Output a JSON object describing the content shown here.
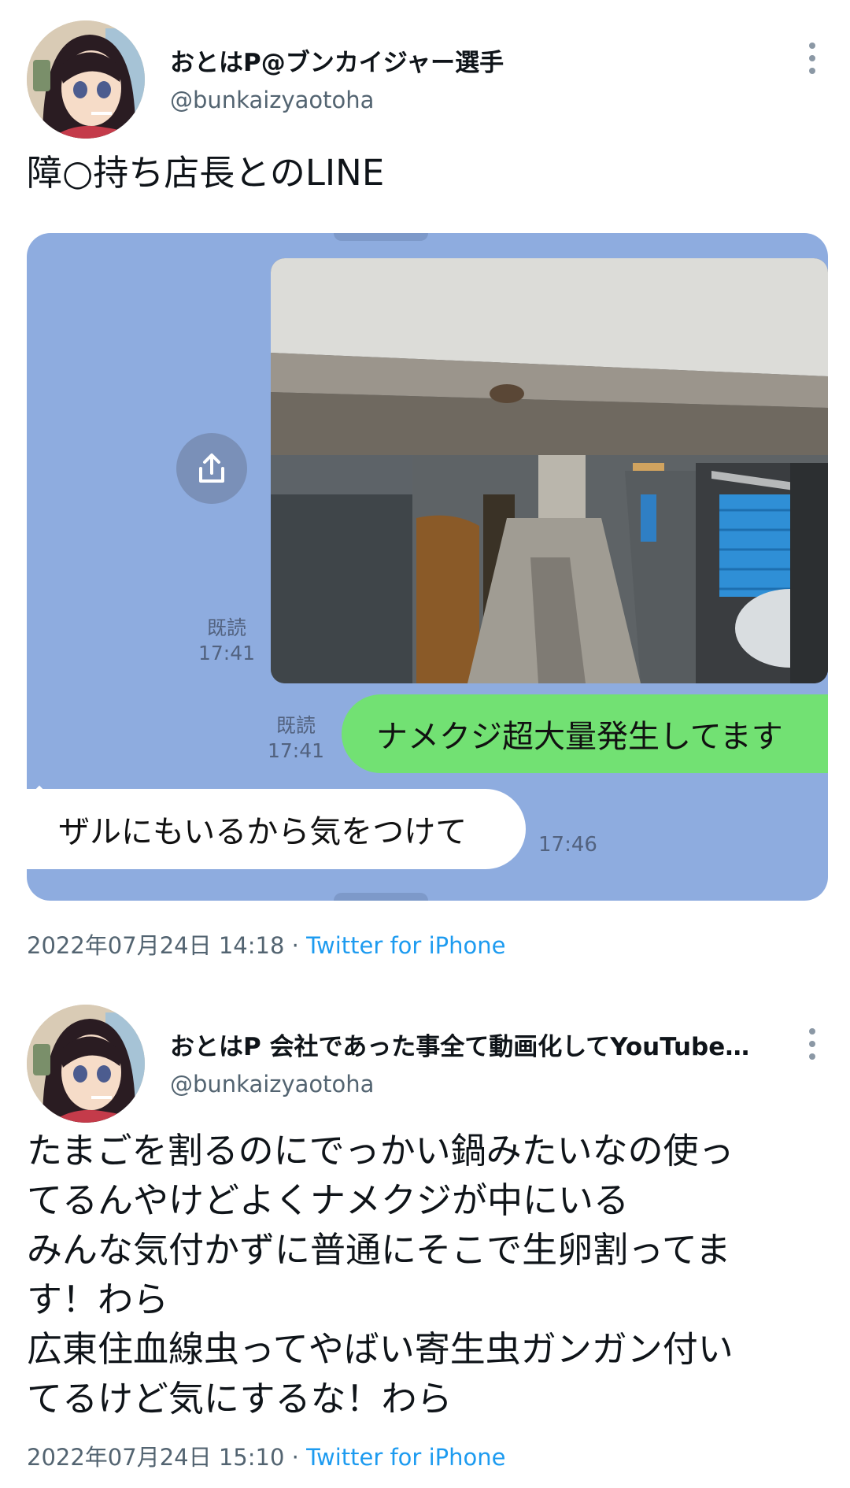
{
  "tweet1": {
    "display_name": "おとはP@ブンカイジャー選手",
    "handle": "@bunkaizyaotoha",
    "text": "障○持ち店長とのLINE",
    "timestamp": "2022年07月24日 14:18",
    "separator": "·",
    "via": "Twitter for iPhone",
    "line_chat": {
      "photo_read": "既読",
      "photo_time": "17:41",
      "sent_message": "ナメクジ超大量発生してます",
      "sent_read": "既読",
      "sent_time": "17:41",
      "received_message": "ザルにもいるから気をつけて",
      "received_time": "17:46"
    }
  },
  "tweet2": {
    "display_name": "おとはP 会社であった事全て動画化してYouTube…",
    "handle": "@bunkaizyaotoha",
    "text": "たまごを割るのにでっかい鍋みたいなの使っ\nてるんやけどよくナメクジが中にいる\nみんな気付かずに普通にそこで生卵割ってま\nす！わら\n広東住血線虫ってやばい寄生虫ガンガン付い\nてるけど気にするな！わら",
    "timestamp": "2022年07月24日 15:10",
    "separator": "·",
    "via": "Twitter for iPhone"
  },
  "colors": {
    "link": "#1d9bf0",
    "secondary_text": "#536471",
    "line_background": "#8eacdf",
    "line_green_bubble": "#72e173"
  },
  "icons": [
    "more-vertical-icon",
    "share-icon"
  ]
}
